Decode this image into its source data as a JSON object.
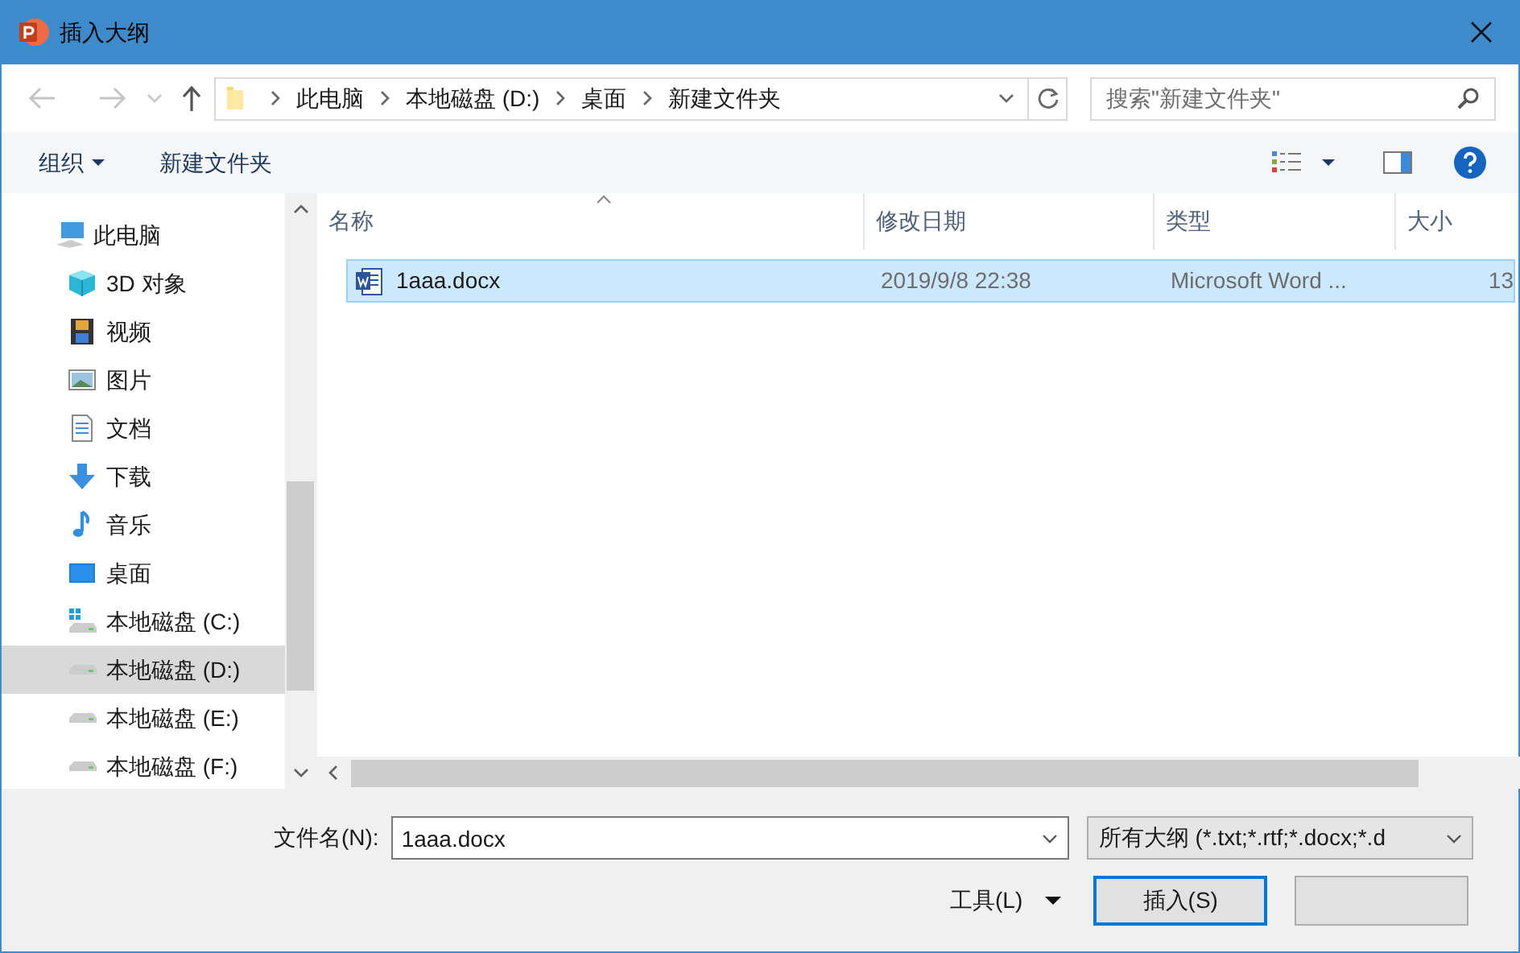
{
  "window": {
    "title": "插入大纲"
  },
  "address": {
    "path": [
      "此电脑",
      "本地磁盘 (D:)",
      "桌面",
      "新建文件夹"
    ]
  },
  "search": {
    "placeholder": "搜索\"新建文件夹\""
  },
  "toolbar": {
    "organize": "组织",
    "new_folder": "新建文件夹"
  },
  "sidebar": {
    "items": [
      {
        "label": "此电脑",
        "kind": "pc",
        "selected": false
      },
      {
        "label": "3D 对象",
        "kind": "cube",
        "selected": false
      },
      {
        "label": "视频",
        "kind": "film",
        "selected": false
      },
      {
        "label": "图片",
        "kind": "picture",
        "selected": false
      },
      {
        "label": "文档",
        "kind": "document",
        "selected": false
      },
      {
        "label": "下载",
        "kind": "download",
        "selected": false
      },
      {
        "label": "音乐",
        "kind": "music",
        "selected": false
      },
      {
        "label": "桌面",
        "kind": "desktop",
        "selected": false
      },
      {
        "label": "本地磁盘 (C:)",
        "kind": "system-drive",
        "selected": false
      },
      {
        "label": "本地磁盘 (D:)",
        "kind": "drive",
        "selected": true
      },
      {
        "label": "本地磁盘 (E:)",
        "kind": "drive",
        "selected": false
      },
      {
        "label": "本地磁盘 (F:)",
        "kind": "drive",
        "selected": false
      }
    ]
  },
  "table": {
    "columns": [
      "名称",
      "修改日期",
      "类型",
      "大小"
    ],
    "rows": [
      {
        "name": "1aaa.docx",
        "modified": "2019/9/8 22:38",
        "type": "Microsoft Word ...",
        "size": "13",
        "selected": true
      }
    ]
  },
  "file_name": {
    "label": "文件名(N):",
    "value": "1aaa.docx"
  },
  "file_type": {
    "value": "所有大纲 (*.txt;*.rtf;*.docx;*.d"
  },
  "tools": {
    "label": "工具(L)"
  },
  "buttons": {
    "insert": "插入(S)"
  }
}
